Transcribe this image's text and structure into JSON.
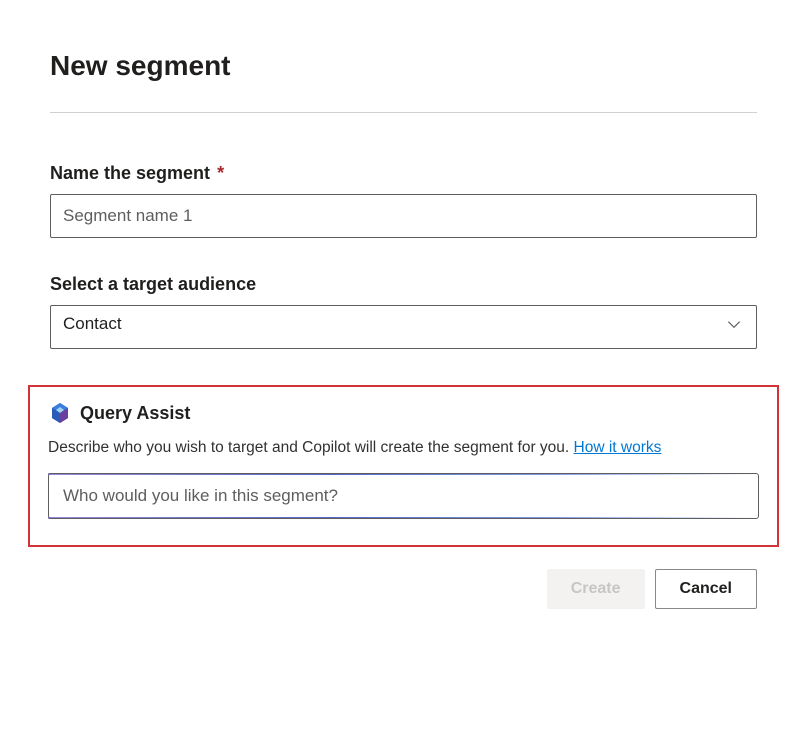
{
  "page": {
    "title": "New segment"
  },
  "fields": {
    "name": {
      "label": "Name the segment",
      "required_marker": "*",
      "value": "Segment name 1"
    },
    "audience": {
      "label": "Select a target audience",
      "selected": "Contact"
    }
  },
  "query_assist": {
    "title": "Query Assist",
    "description": "Describe who you wish to target and Copilot will create the segment for you.",
    "link_text": "How it works",
    "placeholder": "Who would you like in this segment?"
  },
  "buttons": {
    "create": "Create",
    "cancel": "Cancel"
  }
}
